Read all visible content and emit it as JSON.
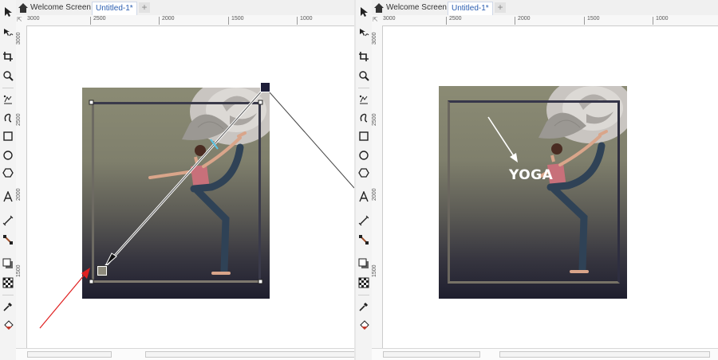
{
  "app": {
    "tabs": [
      {
        "label": "Welcome Screen",
        "active": false
      },
      {
        "label": "Untitled-1*",
        "active": true
      }
    ],
    "new_tab_label": "+"
  },
  "rulers": {
    "horizontal": [
      "3000",
      "2500",
      "2000",
      "1500",
      "1000"
    ],
    "vertical": [
      "3000",
      "2500",
      "2000",
      "1500"
    ]
  },
  "toolbox": [
    "pick-tool-icon",
    "shape-tool-icon",
    "crop-tool-icon",
    "zoom-tool-icon",
    "freehand-tool-icon",
    "artistic-media-icon",
    "rectangle-tool-icon",
    "ellipse-tool-icon",
    "polygon-tool-icon",
    "text-tool-icon",
    "parallel-dimension-icon",
    "connector-tool-icon",
    "drop-shadow-icon",
    "transparency-tool-icon",
    "eyedropper-tool-icon",
    "interactive-fill-icon"
  ],
  "artwork": {
    "caption": "YOGA",
    "colors": {
      "gradient_top": "#8b8b74",
      "gradient_bottom": "#1e1e2e",
      "frame_dark": "#3a3a4a",
      "frame_light": "#7d786e",
      "annotation_arrow": "#e02020",
      "handle_dark": "#1f1f3a",
      "handle_light": "#8d8a7b",
      "rose": "#cfcbc6"
    }
  }
}
